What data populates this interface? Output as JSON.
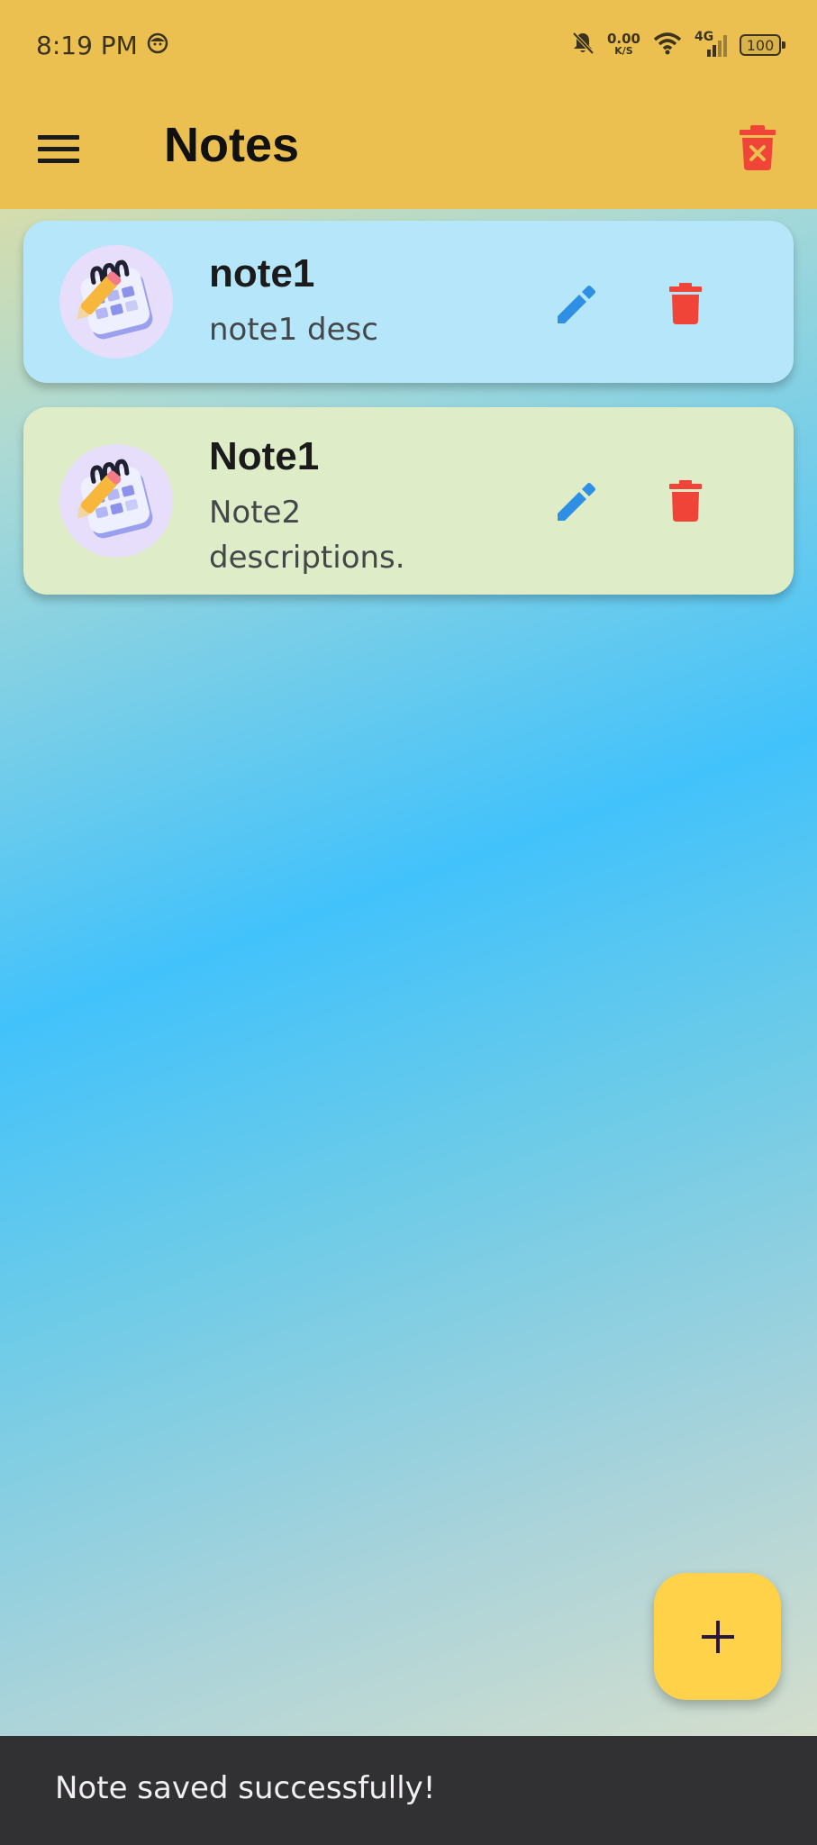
{
  "status_bar": {
    "time": "8:19 PM",
    "net_speed_value": "0.00",
    "net_speed_unit": "K/S",
    "network_type": "4G",
    "battery": "100"
  },
  "app_bar": {
    "title": "Notes"
  },
  "notes": [
    {
      "title": "note1",
      "description": "note1 desc"
    },
    {
      "title": "Note1",
      "description": "Note2 descriptions."
    }
  ],
  "snackbar": {
    "message": "Note saved successfully!"
  },
  "colors": {
    "app_bar": "#ebc050",
    "card_1": "#b6e6fa",
    "card_2": "#deecc8",
    "edit_icon": "#2e8fe4",
    "delete_icon": "#f04438",
    "fab": "#ffd24a",
    "snackbar": "#313033"
  },
  "icons": {
    "menu": "menu-icon",
    "delete_all": "delete-all-icon",
    "edit": "pencil-icon",
    "delete": "trash-icon",
    "add": "plus-icon",
    "note_avatar": "notepad-illustration-icon"
  }
}
